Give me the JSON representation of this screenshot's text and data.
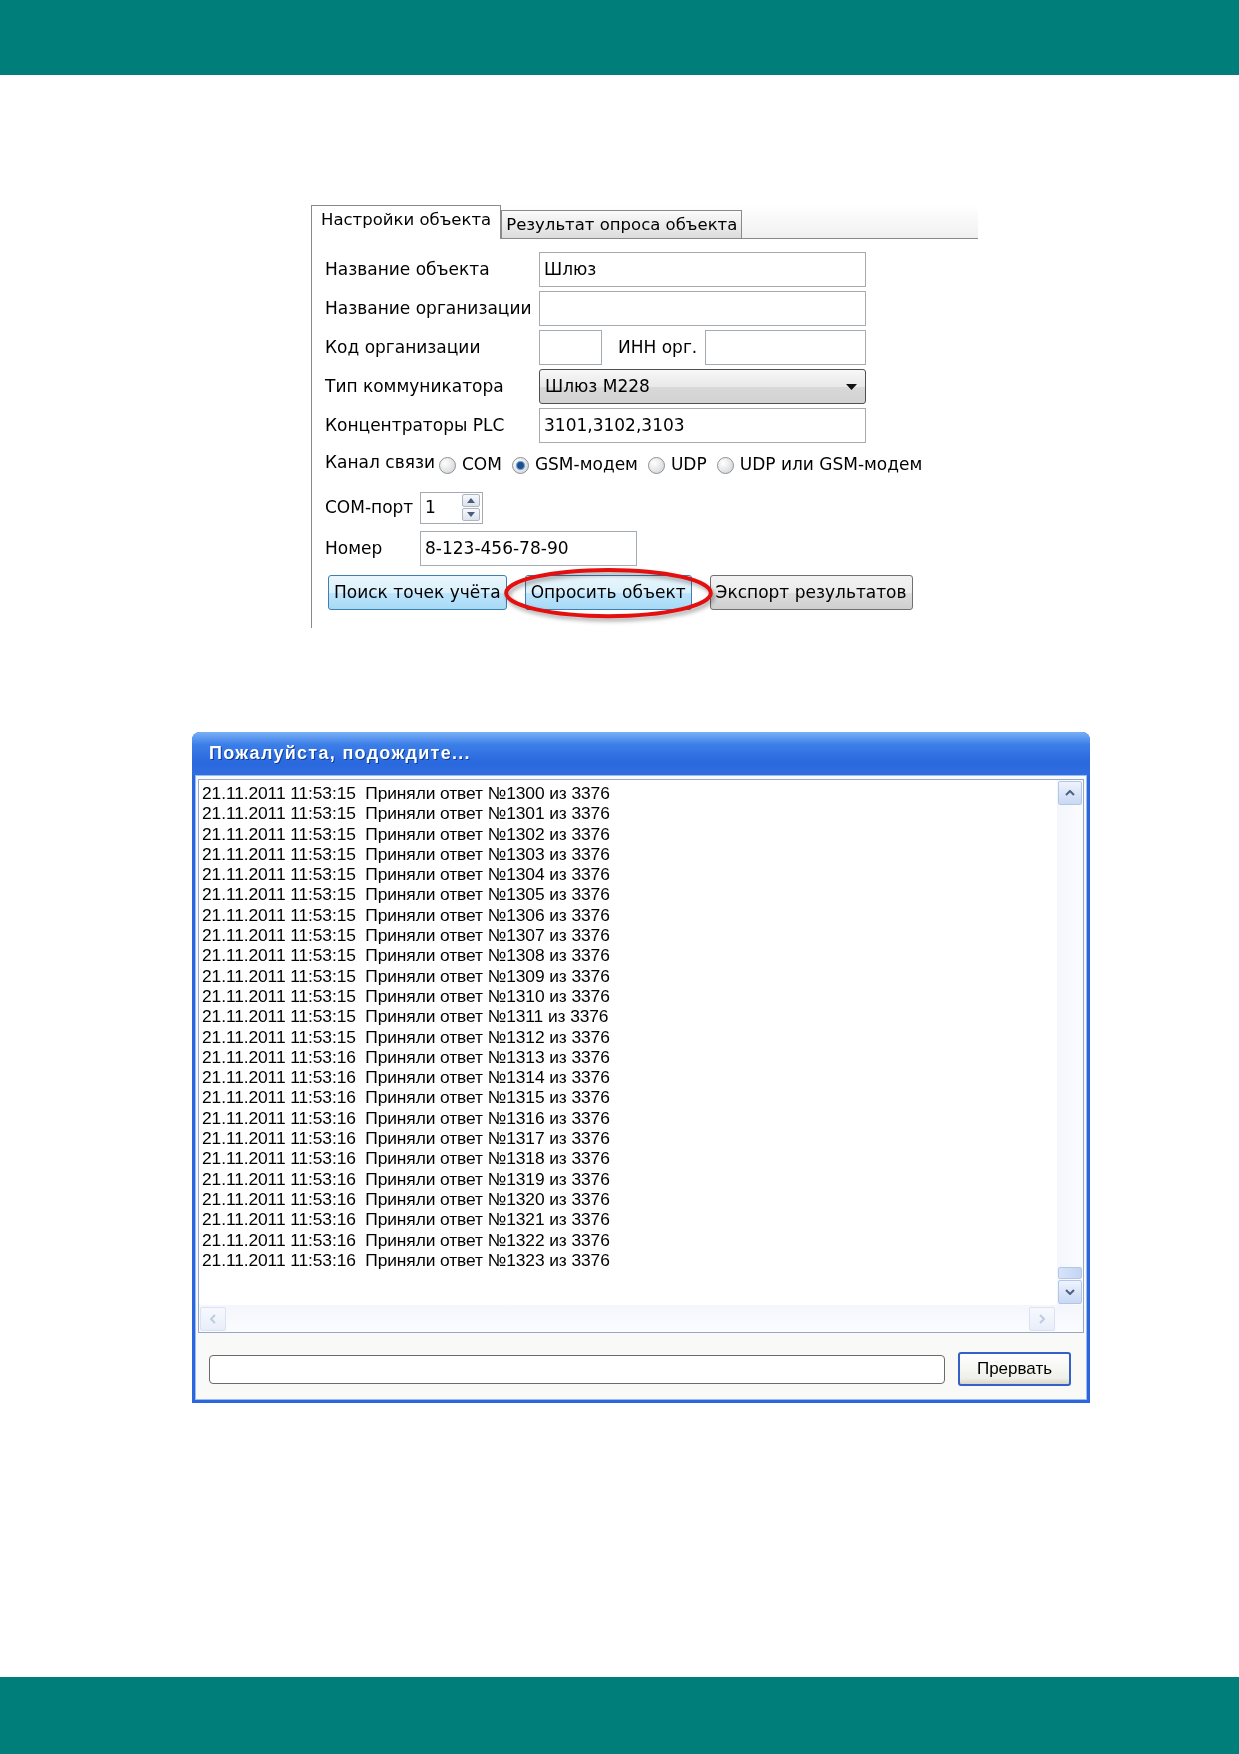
{
  "settings_form": {
    "tabs": [
      {
        "label": "Настройки объекта",
        "selected": true
      },
      {
        "label": "Результат опроса объекта",
        "selected": false
      }
    ],
    "rows": [
      {
        "kind": "text",
        "label": "Название объекта",
        "value": "Шлюз"
      },
      {
        "kind": "text",
        "label": "Название организации"
      },
      {
        "kind": "pair",
        "label": "Код организации",
        "label_2": "ИНН орг."
      },
      {
        "kind": "select",
        "label": "Тип коммуникатора",
        "value": "Шлюз М228"
      },
      {
        "kind": "text",
        "label": "Концентраторы PLC",
        "value": "3101,3102,3103"
      },
      {
        "kind": "radio",
        "label": "Канал связи",
        "options": [
          {
            "label": "COM",
            "selected": false
          },
          {
            "label": "GSM-модем",
            "selected": true
          },
          {
            "label": "UDP",
            "selected": false
          },
          {
            "label": "UDP или GSM-модем",
            "selected": false
          }
        ]
      },
      {
        "kind": "spin",
        "label": "COM-порт",
        "value": "1"
      },
      {
        "kind": "short",
        "label": "Номер",
        "value": "8-123-456-78-90"
      }
    ],
    "buttons": [
      {
        "label": "Поиск точек учёта",
        "highlighted": true,
        "circled": false
      },
      {
        "label": "Опросить объект",
        "highlighted": true,
        "circled": true
      },
      {
        "label": "Экспорт результатов",
        "highlighted": false,
        "circled": false
      }
    ]
  },
  "dialog": {
    "title": "Пожалуйста, подождите...",
    "log": [
      "21.11.2011 11:53:15  Приняли ответ №1300 из 3376",
      "21.11.2011 11:53:15  Приняли ответ №1301 из 3376",
      "21.11.2011 11:53:15  Приняли ответ №1302 из 3376",
      "21.11.2011 11:53:15  Приняли ответ №1303 из 3376",
      "21.11.2011 11:53:15  Приняли ответ №1304 из 3376",
      "21.11.2011 11:53:15  Приняли ответ №1305 из 3376",
      "21.11.2011 11:53:15  Приняли ответ №1306 из 3376",
      "21.11.2011 11:53:15  Приняли ответ №1307 из 3376",
      "21.11.2011 11:53:15  Приняли ответ №1308 из 3376",
      "21.11.2011 11:53:15  Приняли ответ №1309 из 3376",
      "21.11.2011 11:53:15  Приняли ответ №1310 из 3376",
      "21.11.2011 11:53:15  Приняли ответ №1311 из 3376",
      "21.11.2011 11:53:15  Приняли ответ №1312 из 3376",
      "21.11.2011 11:53:16  Приняли ответ №1313 из 3376",
      "21.11.2011 11:53:16  Приняли ответ №1314 из 3376",
      "21.11.2011 11:53:16  Приняли ответ №1315 из 3376",
      "21.11.2011 11:53:16  Приняли ответ №1316 из 3376",
      "21.11.2011 11:53:16  Приняли ответ №1317 из 3376",
      "21.11.2011 11:53:16  Приняли ответ №1318 из 3376",
      "21.11.2011 11:53:16  Приняли ответ №1319 из 3376",
      "21.11.2011 11:53:16  Приняли ответ №1320 из 3376",
      "21.11.2011 11:53:16  Приняли ответ №1321 из 3376",
      "21.11.2011 11:53:16  Приняли ответ №1322 из 3376",
      "21.11.2011 11:53:16  Приняли ответ №1323 из 3376"
    ],
    "progress": {
      "level": 0
    },
    "button": "Прервать"
  }
}
